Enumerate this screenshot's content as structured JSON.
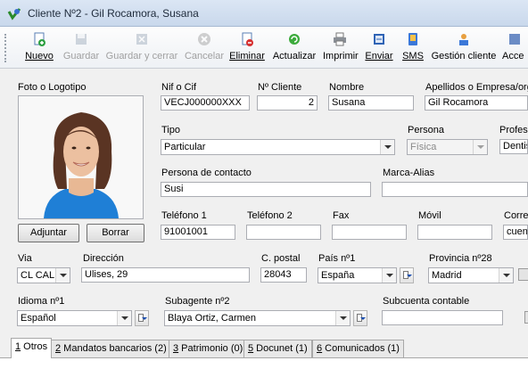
{
  "window": {
    "title": "Cliente Nº2 - Gil Rocamora, Susana"
  },
  "toolbar": {
    "buttons": [
      {
        "label": "Nuevo",
        "icon": "new-document-icon",
        "enabled": true
      },
      {
        "label": "Guardar",
        "icon": "save-icon",
        "enabled": false
      },
      {
        "label": "Guardar y cerrar",
        "icon": "save-close-icon",
        "enabled": false
      },
      {
        "label": "Cancelar",
        "icon": "cancel-icon",
        "enabled": false
      },
      {
        "label": "Eliminar",
        "icon": "delete-document-icon",
        "enabled": true
      },
      {
        "label": "Actualizar",
        "icon": "refresh-icon",
        "enabled": true
      },
      {
        "label": "Imprimir",
        "icon": "printer-icon",
        "enabled": true
      },
      {
        "label": "Enviar",
        "icon": "send-icon",
        "enabled": true
      },
      {
        "label": "SMS",
        "icon": "sms-icon",
        "enabled": true
      },
      {
        "label": "Gestión cliente",
        "icon": "client-management-icon",
        "enabled": true
      },
      {
        "label": "Acce",
        "icon": "access-icon",
        "enabled": true
      }
    ]
  },
  "photo": {
    "label": "Foto o Logotipo",
    "adjuntar": "Adjuntar",
    "borrar": "Borrar"
  },
  "form": {
    "nif": {
      "label": "Nif o Cif",
      "value": "VECJ000000XXX"
    },
    "num_cliente": {
      "label": "Nº Cliente",
      "value": "2"
    },
    "nombre": {
      "label": "Nombre",
      "value": "Susana"
    },
    "apellidos": {
      "label": "Apellidos o Empresa/org",
      "value": "Gil Rocamora"
    },
    "tipo": {
      "label": "Tipo",
      "value": "Particular"
    },
    "persona": {
      "label": "Persona",
      "value": "Física"
    },
    "profesion": {
      "label": "Profesi",
      "value": "Dentis"
    },
    "contacto": {
      "label": "Persona de contacto",
      "value": "Susi"
    },
    "marca": {
      "label": "Marca-Alias",
      "value": ""
    },
    "telefono1": {
      "label": "Teléfono 1",
      "value": "91001001"
    },
    "telefono2": {
      "label": "Teléfono 2",
      "value": ""
    },
    "fax": {
      "label": "Fax",
      "value": ""
    },
    "movil": {
      "label": "Móvil",
      "value": ""
    },
    "correo": {
      "label": "Corre",
      "value": "cuen"
    },
    "via": {
      "label": "Via",
      "value": "CL CAL"
    },
    "direccion": {
      "label": "Dirección",
      "value": "Ulises, 29"
    },
    "cpostal": {
      "label": "C. postal",
      "value": "28043"
    },
    "pais": {
      "label": "País nº1",
      "value": "España"
    },
    "provincia": {
      "label": "Provincia nº28",
      "value": "Madrid"
    },
    "idioma": {
      "label": "Idioma nº1",
      "value": "Español"
    },
    "subagente": {
      "label": "Subagente nº2",
      "value": "Blaya Ortiz, Carmen"
    },
    "subcuenta": {
      "label": "Subcuenta contable",
      "value": ""
    }
  },
  "tabs": [
    {
      "num": "1",
      "label": " Otros"
    },
    {
      "num": "2",
      "label": " Mandatos bancarios (2)"
    },
    {
      "num": "3",
      "label": " Patrimonio (0)"
    },
    {
      "num": "5",
      "label": " Docunet (1)"
    },
    {
      "num": "6",
      "label": " Comunicados (1)"
    }
  ],
  "colors": {
    "accent": "#1f6fd1",
    "title_bg": "#d3e1f2"
  }
}
